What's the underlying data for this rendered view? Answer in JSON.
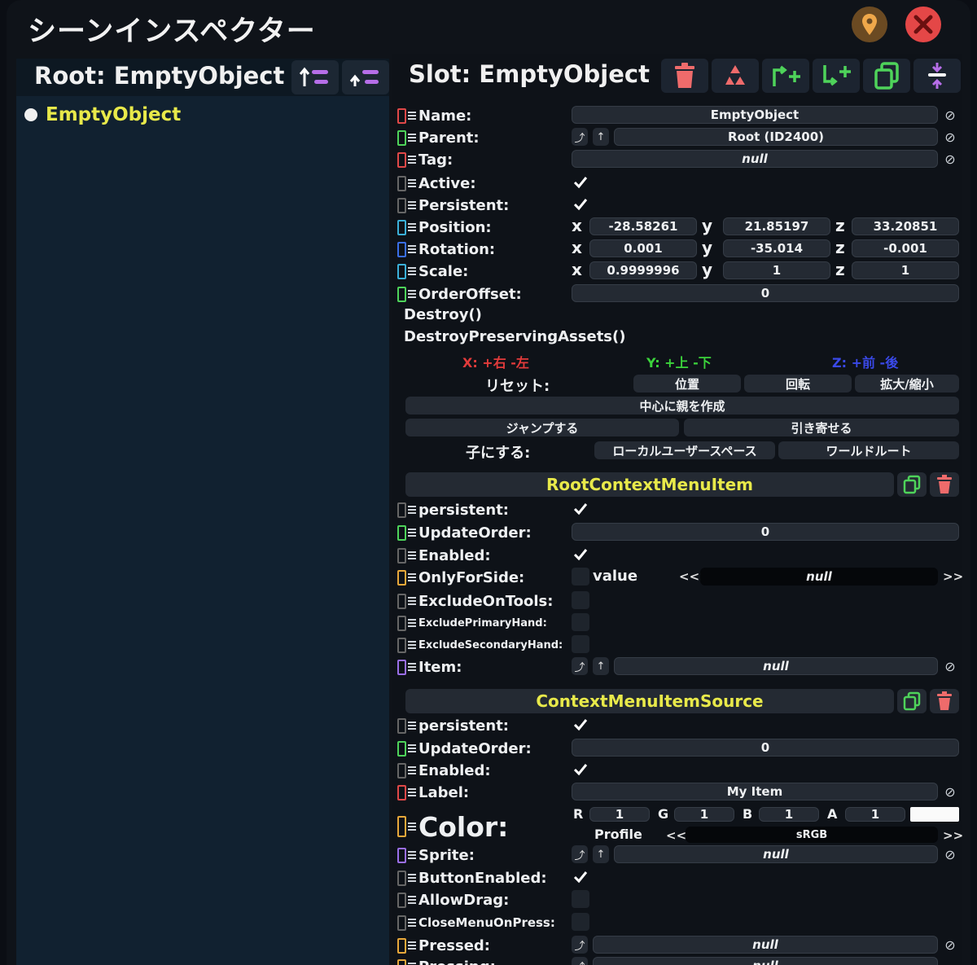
{
  "window": {
    "title": "シーンインスペクター"
  },
  "colors": {
    "accent_yellow": "#e8e94a",
    "green": "#39d353",
    "red": "#e84a4a",
    "axis_x": "#e23b3b",
    "axis_y": "#3bd33b",
    "axis_z": "#3a49e8"
  },
  "hierarchy": {
    "root_title": "Root: EmptyObject",
    "items": [
      {
        "label": "EmptyObject"
      }
    ]
  },
  "slot": {
    "title": "Slot: EmptyObject",
    "fields": {
      "name": {
        "label": "Name:",
        "value": "EmptyObject"
      },
      "parent": {
        "label": "Parent:",
        "value": "Root (ID2400)"
      },
      "tag": {
        "label": "Tag:",
        "value": "null"
      },
      "active": {
        "label": "Active:"
      },
      "persistent": {
        "label": "Persistent:"
      },
      "position": {
        "label": "Position:",
        "x": "-28.58261",
        "y": "21.85197",
        "z": "33.20851"
      },
      "rotation": {
        "label": "Rotation:",
        "x": "0.001",
        "y": "-35.014",
        "z": "-0.001"
      },
      "scale": {
        "label": "Scale:",
        "x": "0.9999996",
        "y": "1",
        "z": "1"
      },
      "order_offset": {
        "label": "OrderOffset:",
        "value": "0"
      }
    },
    "axis_labels": {
      "x": "x",
      "y": "y",
      "z": "z"
    },
    "actions": {
      "destroy": "Destroy()",
      "destroy_preserving": "DestroyPreservingAssets()"
    },
    "axis_legend": {
      "x": "X: +右 -左",
      "y": "Y: +上 -下",
      "z": "Z: +前 -後"
    },
    "reset": {
      "label": "リセット:",
      "position": "位置",
      "rotation": "回転",
      "scale": "拡大/縮小"
    },
    "create_parent": "中心に親を作成",
    "jump": "ジャンプする",
    "bring": "引き寄せる",
    "child_of": {
      "label": "子にする:",
      "local_user_space": "ローカルユーザースペース",
      "world_root": "ワールドルート"
    }
  },
  "components": [
    {
      "title": "RootContextMenuItem",
      "fields": {
        "persistent": "persistent:",
        "update_order": {
          "label": "UpdateOrder:",
          "value": "0"
        },
        "enabled": "Enabled:",
        "only_for_side": {
          "label": "OnlyForSide:",
          "sub_label": "value",
          "value": "null",
          "left": "<<",
          "right": ">>"
        },
        "exclude_on_tools": "ExcludeOnTools:",
        "exclude_primary": "ExcludePrimaryHand:",
        "exclude_secondary": "ExcludeSecondaryHand:",
        "item": {
          "label": "Item:",
          "value": "null"
        }
      }
    },
    {
      "title": "ContextMenuItemSource",
      "fields": {
        "persistent": "persistent:",
        "update_order": {
          "label": "UpdateOrder:",
          "value": "0"
        },
        "enabled": "Enabled:",
        "label": {
          "label": "Label:",
          "value": "My Item"
        },
        "color": {
          "label": "Color:",
          "r_label": "R",
          "g_label": "G",
          "b_label": "B",
          "a_label": "A",
          "r": "1",
          "g": "1",
          "b": "1",
          "a": "1",
          "profile_label": "Profile",
          "profile": "sRGB",
          "left": "<<",
          "right": ">>"
        },
        "sprite": {
          "label": "Sprite:",
          "value": "null"
        },
        "button_enabled": "ButtonEnabled:",
        "allow_drag": "AllowDrag:",
        "close_menu": "CloseMenuOnPress:",
        "pressed": {
          "label": "Pressed:",
          "value": "null"
        },
        "pressing": {
          "label": "Pressing:",
          "value": "null"
        }
      }
    }
  ],
  "symbols": {
    "null_btn": "⊘",
    "ref_up": "⤴",
    "ref_arrow": "↑"
  }
}
